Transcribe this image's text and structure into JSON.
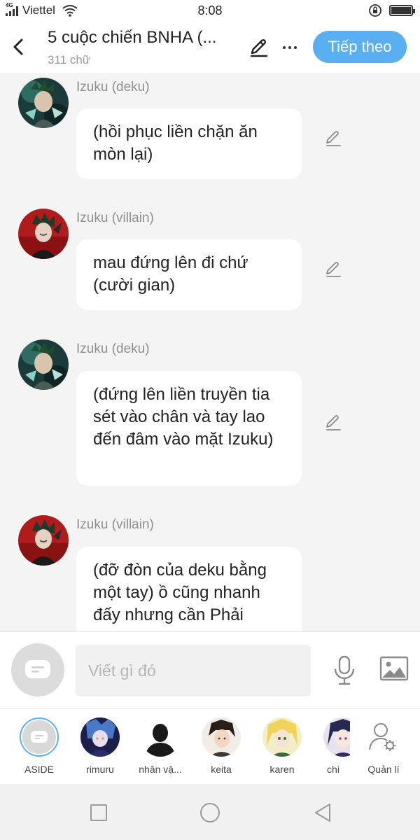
{
  "status_bar": {
    "network_type": "4G",
    "carrier": "Viettel",
    "time": "8:08"
  },
  "header": {
    "title": "5 cuộc chiến BNHA (...",
    "word_count": "311 chữ",
    "next_label": "Tiếp theo"
  },
  "messages": [
    {
      "sender": "Izuku (deku)",
      "text": "(hồi phục liền chặn ăn mòn lại)",
      "avatar": "deku"
    },
    {
      "sender": "Izuku (villain)",
      "text": "mau đứng lên đi chứ (cười gian)",
      "avatar": "villain"
    },
    {
      "sender": "Izuku (deku)",
      "text": "(đứng lên liền truyền tia sét vào chân và tay lao đến đâm vào mặt Izuku)",
      "avatar": "deku"
    },
    {
      "sender": "Izuku (villain)",
      "text": "(đỡ đòn của deku bằng một tay) ồ cũng nhanh đấy nhưng cần Phải",
      "avatar": "villain"
    }
  ],
  "input": {
    "placeholder": "Viết gì đó",
    "value": ""
  },
  "characters": [
    {
      "label": "ASIDE",
      "avatar": "aside-icon"
    },
    {
      "label": "rimuru",
      "avatar": "rimuru"
    },
    {
      "label": "nhân vậ...",
      "avatar": "silhouette"
    },
    {
      "label": "keita",
      "avatar": "keita"
    },
    {
      "label": "karen",
      "avatar": "karen"
    },
    {
      "label": "chi",
      "avatar": "chi"
    }
  ],
  "manage_label": "Quản lí",
  "colors": {
    "accent": "#5aaff3",
    "background": "#f4f4f4",
    "bubble": "#ffffff",
    "name_text": "#8f8f8f"
  }
}
